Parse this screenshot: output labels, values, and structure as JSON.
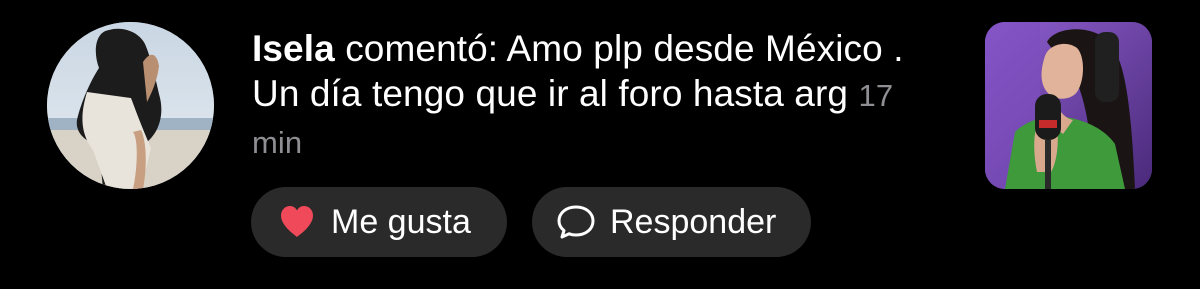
{
  "comment": {
    "username": "Isela",
    "verb": "comentó:",
    "text": "Amo plp desde México . Un día tengo que ir al foro hasta arg",
    "time": "17 min"
  },
  "actions": {
    "like_label": "Me gusta",
    "like_icon": "heart-icon",
    "like_color": "#f04a5a",
    "reply_label": "Responder",
    "reply_icon": "speech-bubble-icon"
  },
  "colors": {
    "background": "#000000",
    "button_bg": "#2a2a2a",
    "text": "#ffffff",
    "timestamp": "#8e8e93"
  }
}
